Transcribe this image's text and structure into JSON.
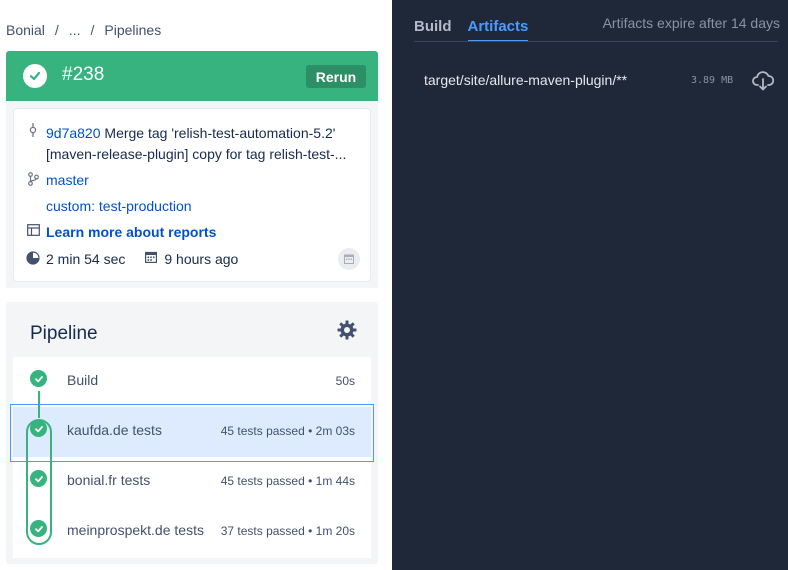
{
  "breadcrumb": {
    "project": "Bonial",
    "sep": "/",
    "ellipsis": "...",
    "current": "Pipelines"
  },
  "build": {
    "number": "#238",
    "status": "successful",
    "rerun_label": "Rerun"
  },
  "details": {
    "commit_hash": "9d7a820",
    "commit_message_line1": " Merge tag 'relish-test-automation-5.2'",
    "commit_message_line2": "[maven-release-plugin] copy for tag relish-test-...",
    "branch": "master",
    "pipeline_name": "custom: test-production",
    "reports_link": "Learn more about reports",
    "duration": "2 min 54 sec",
    "time_ago": "9 hours ago"
  },
  "pipeline": {
    "title": "Pipeline",
    "steps": [
      {
        "name": "Build",
        "info": "50s"
      },
      {
        "name": "kaufda.de tests",
        "info": "45 tests passed • 2m 03s"
      },
      {
        "name": "bonial.fr tests",
        "info": "45 tests passed • 1m 44s"
      },
      {
        "name": "meinprospekt.de tests",
        "info": "37 tests passed • 1m 20s"
      }
    ]
  },
  "right": {
    "tabs": [
      "Build",
      "Artifacts"
    ],
    "active_tab": "Artifacts",
    "expire_note": "Artifacts expire after 14 days",
    "artifact": {
      "path": "target/site/allure-maven-plugin/**",
      "size": "3.89 MB"
    }
  },
  "colors": {
    "success": "#36b37e",
    "accent": "#4c9aff",
    "dark_bg": "#1e2838",
    "link": "#0052cc"
  },
  "icons": [
    "check-icon",
    "commit-icon",
    "branch-icon",
    "report-icon",
    "clock-icon",
    "calendar-icon",
    "gear-icon",
    "cloud-download-icon"
  ]
}
